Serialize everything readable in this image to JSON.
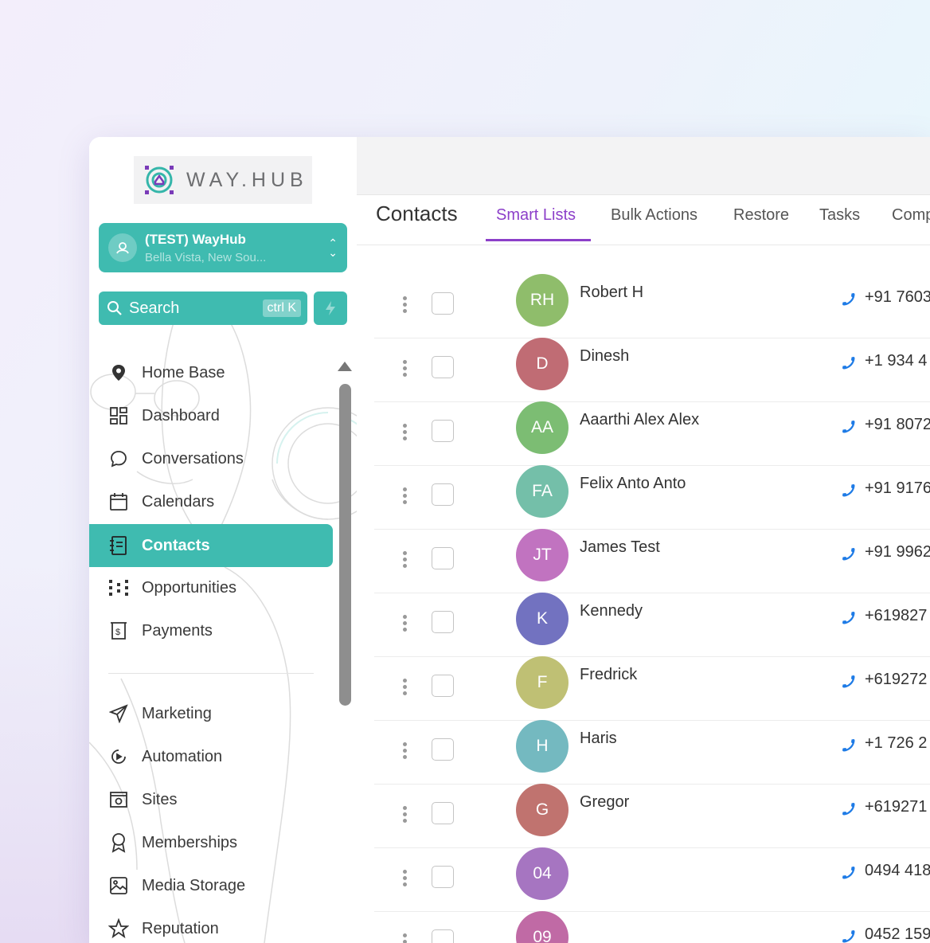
{
  "brand": {
    "logo_text": "WAY.HUB"
  },
  "account": {
    "name": "(TEST) WayHub",
    "location": "Bella Vista, New Sou..."
  },
  "search": {
    "label": "Search",
    "shortcut": "ctrl K"
  },
  "nav": {
    "items": [
      {
        "label": "Home Base",
        "icon": "location-pin-icon"
      },
      {
        "label": "Dashboard",
        "icon": "dashboard-grid-icon"
      },
      {
        "label": "Conversations",
        "icon": "chat-bubble-icon"
      },
      {
        "label": "Calendars",
        "icon": "calendar-icon"
      },
      {
        "label": "Contacts",
        "icon": "contact-book-icon",
        "active": true
      },
      {
        "label": "Opportunities",
        "icon": "opportunities-icon"
      },
      {
        "label": "Payments",
        "icon": "payments-icon"
      }
    ],
    "secondary": [
      {
        "label": "Marketing",
        "icon": "paper-plane-icon"
      },
      {
        "label": "Automation",
        "icon": "automation-icon"
      },
      {
        "label": "Sites",
        "icon": "sites-icon"
      },
      {
        "label": "Memberships",
        "icon": "award-icon"
      },
      {
        "label": "Media Storage",
        "icon": "image-icon"
      },
      {
        "label": "Reputation",
        "icon": "star-icon"
      }
    ]
  },
  "header": {
    "title": "Contacts",
    "tabs": [
      "Smart Lists",
      "Bulk Actions",
      "Restore",
      "Tasks",
      "Comp"
    ],
    "active_tab": "Smart Lists"
  },
  "colors": {
    "accent": "#3fbbb0",
    "tab_active": "#8c3fc9",
    "phone_icon": "#1e7be6"
  },
  "contacts": [
    {
      "initials": "RH",
      "name": "Robert H",
      "phone": "+91 7603",
      "color": "#8fbd6b"
    },
    {
      "initials": "D",
      "name": "Dinesh",
      "phone": "+1 934 4",
      "color": "#c06c74"
    },
    {
      "initials": "AA",
      "name": "Aaarthi Alex Alex",
      "phone": "+91 8072",
      "color": "#7cbd73"
    },
    {
      "initials": "FA",
      "name": "Felix Anto Anto",
      "phone": "+91 9176",
      "color": "#74bfa9"
    },
    {
      "initials": "JT",
      "name": "James Test",
      "phone": "+91 9962",
      "color": "#c173c0"
    },
    {
      "initials": "K",
      "name": "Kennedy",
      "phone": "+619827",
      "color": "#7272c0"
    },
    {
      "initials": "F",
      "name": "Fredrick",
      "phone": "+619272",
      "color": "#bfc074"
    },
    {
      "initials": "H",
      "name": "Haris",
      "phone": "+1 726 2",
      "color": "#74b9c0"
    },
    {
      "initials": "G",
      "name": "Gregor",
      "phone": "+619271",
      "color": "#c0736f"
    },
    {
      "initials": "04",
      "name": "",
      "phone": "0494 418",
      "color": "#a675c1"
    },
    {
      "initials": "09",
      "name": "",
      "phone": "0452 159",
      "color": "#c06aa5"
    }
  ]
}
